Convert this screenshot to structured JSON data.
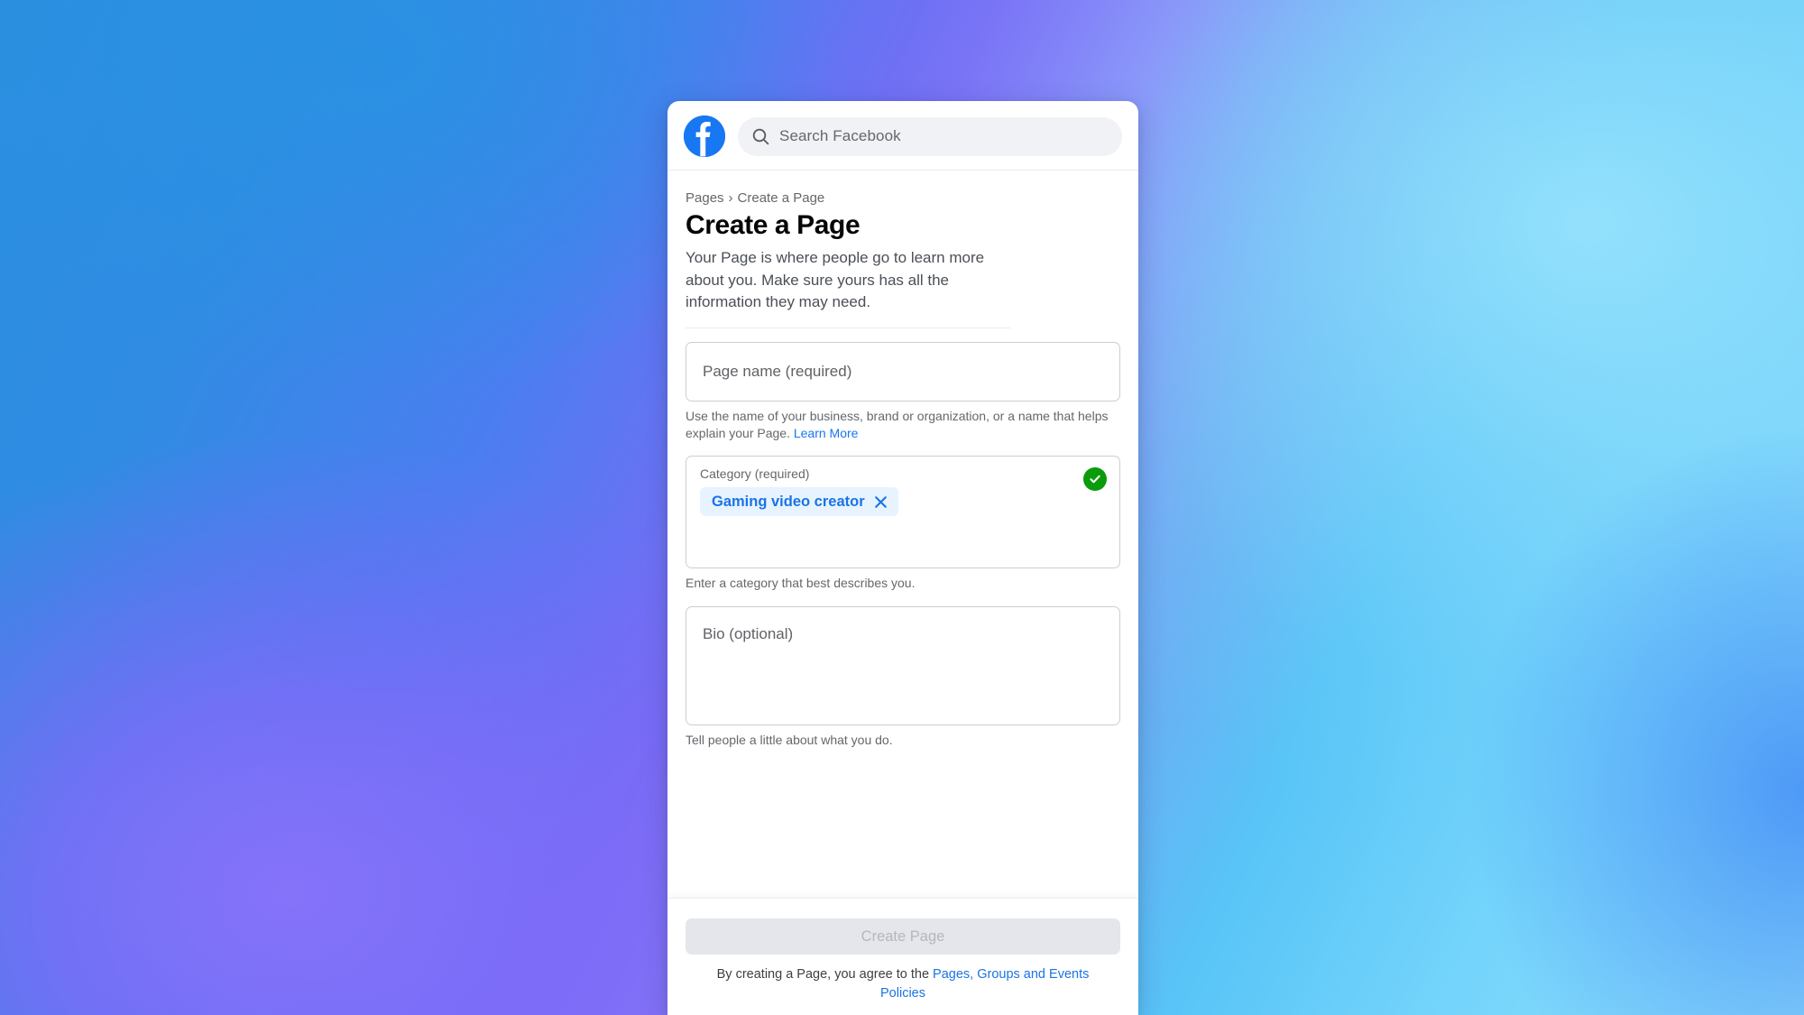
{
  "background": {
    "colors": [
      "#2b8fe0",
      "#7a6cf6",
      "#8f7bf8",
      "#58c4f7",
      "#8fdcfb",
      "#3f89f6"
    ]
  },
  "brand": {
    "logo_icon": "facebook-logo-icon",
    "logo_color": "#1877F2"
  },
  "search": {
    "icon": "search-icon",
    "placeholder": "Search Facebook",
    "value": ""
  },
  "breadcrumb": {
    "root": "Pages",
    "separator": "›",
    "current": "Create a Page"
  },
  "header": {
    "title": "Create a Page",
    "description": "Your Page is where people go to learn more about you. Make sure yours has all the information they may need."
  },
  "fields": {
    "page_name": {
      "placeholder": "Page name (required)",
      "value": "",
      "helper_prefix": "Use the name of your business, brand or organization, or a name that helps explain your Page.",
      "helper_link": "Learn More"
    },
    "category": {
      "label": "Category (required)",
      "value": "",
      "selected_chip": "Gaming video creator",
      "remove_icon": "close-icon",
      "status_icon": "check-circle-icon",
      "status_color": "#0a9c0a",
      "helper": "Enter a category that best describes you."
    },
    "bio": {
      "placeholder": "Bio (optional)",
      "value": "",
      "helper": "Tell people a little about what you do."
    }
  },
  "footer": {
    "submit_label": "Create Page",
    "submit_disabled": true,
    "terms_prefix": "By creating a Page, you agree to the ",
    "terms_link": "Pages, Groups and Events Policies"
  }
}
